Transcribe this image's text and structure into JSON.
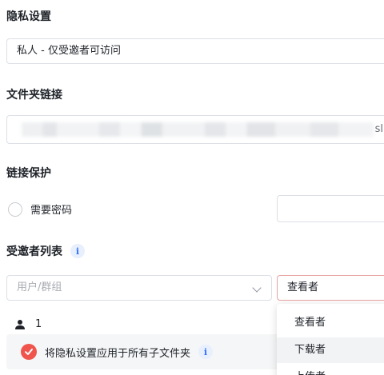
{
  "privacy": {
    "title": "隐私设置",
    "selected": "私人 - 仅受邀者可访问"
  },
  "folder_link": {
    "title": "文件夹链接",
    "suffix": "sl"
  },
  "link_protection": {
    "title": "链接保护",
    "require_password_label": "需要密码",
    "password_value": ""
  },
  "invitees": {
    "title": "受邀者列表",
    "info_icon": "i",
    "user_group_placeholder": "用户/群组",
    "role_selected": "查看者",
    "count": "1"
  },
  "apply_subfolders": {
    "label": "将隐私设置应用于所有子文件夹",
    "checked": true,
    "check_color": "#f0554d"
  },
  "role_dropdown": {
    "options": [
      "查看者",
      "下载者",
      "上传者"
    ]
  },
  "colors": {
    "accent_red": "#f0554d",
    "info_blue": "#3370ff"
  }
}
